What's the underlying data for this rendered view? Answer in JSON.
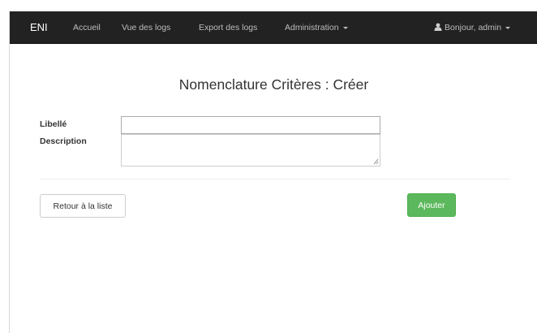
{
  "navbar": {
    "brand": "ENI",
    "links": [
      "Accueil",
      "Vue des logs",
      "Export des logs",
      "Administration"
    ],
    "user_label": "Bonjour, admin",
    "background": "#222222",
    "link_color": "#bdbdbd"
  },
  "page": {
    "title": "Nomenclature Critères : Créer"
  },
  "form": {
    "libelle_label": "Libellé",
    "libelle_value": "",
    "description_label": "Description",
    "description_value": ""
  },
  "actions": {
    "back_label": "Retour à la liste",
    "add_label": "Ajouter",
    "add_color": "#5cb85c"
  }
}
